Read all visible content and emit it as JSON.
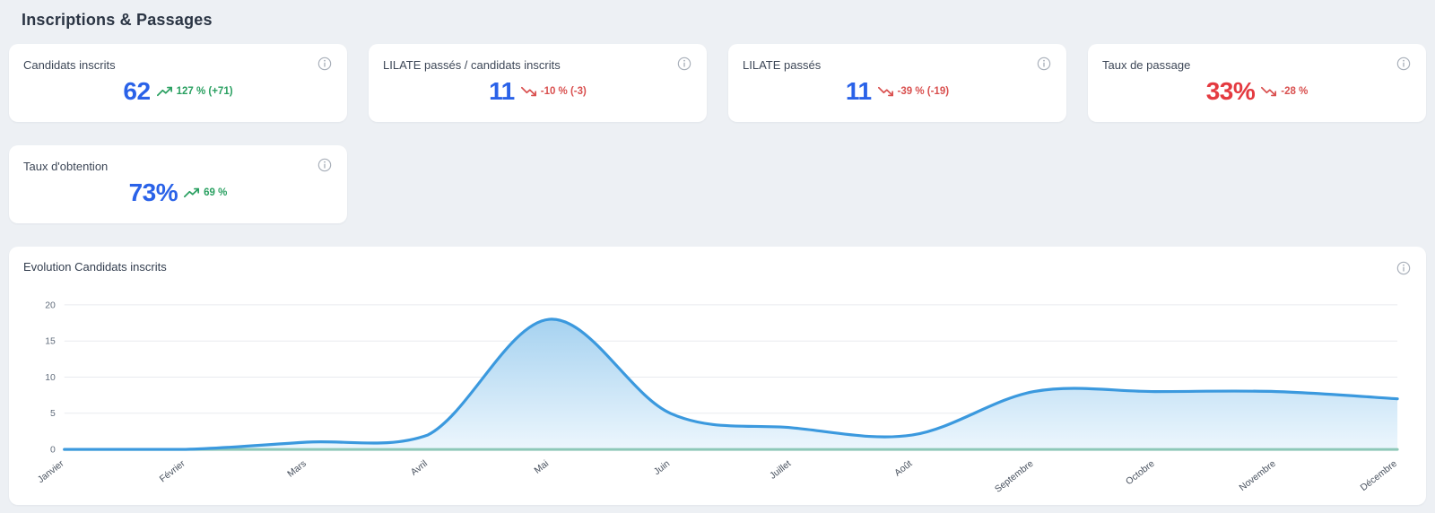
{
  "page": {
    "title": "Inscriptions & Passages"
  },
  "colors": {
    "accent_blue": "#2a62e8",
    "negative_red": "#e43a40",
    "positive_green": "#2aa061",
    "trend_red": "#d9504f",
    "line_blue": "#3b99de",
    "baseline_teal": "#8dc8b8",
    "area_top": "#a6d2f0",
    "area_bottom": "#ecf6fd"
  },
  "cards": [
    {
      "title": "Candidats inscrits",
      "value": "62",
      "value_color": "#2a62e8",
      "trend": "up",
      "trend_text": "127 % (+71)"
    },
    {
      "title": "LILATE passés / candidats inscrits",
      "value": "11",
      "value_color": "#2a62e8",
      "trend": "down",
      "trend_text": "-10 % (-3)"
    },
    {
      "title": "LILATE passés",
      "value": "11",
      "value_color": "#2a62e8",
      "trend": "down",
      "trend_text": "-39 % (-19)"
    },
    {
      "title": "Taux de passage",
      "value": "33%",
      "value_color": "#e43a40",
      "trend": "down",
      "trend_text": "-28 %"
    },
    {
      "title": "Taux d'obtention",
      "value": "73%",
      "value_color": "#2a62e8",
      "trend": "up",
      "trend_text": "69 %"
    }
  ],
  "chart_card": {
    "title": "Evolution Candidats inscrits"
  },
  "chart_data": {
    "type": "area",
    "title": "Evolution Candidats inscrits",
    "categories": [
      "Janvier",
      "Février",
      "Mars",
      "Avril",
      "Mai",
      "Juin",
      "Juillet",
      "Août",
      "Septembre",
      "Octobre",
      "Novembre",
      "Décembre"
    ],
    "series": [
      {
        "name": "Candidats inscrits",
        "values": [
          0,
          0,
          1,
          2,
          18,
          5,
          3,
          2,
          8,
          8,
          8,
          7
        ]
      },
      {
        "name": "baseline",
        "values": [
          0,
          0,
          0,
          0,
          0,
          0,
          0,
          0,
          0,
          0,
          0,
          0
        ]
      }
    ],
    "xlabel": "",
    "ylabel": "",
    "ylim": [
      0,
      20
    ],
    "yticks": [
      0,
      5,
      10,
      15,
      20
    ],
    "grid": true,
    "legend": "none",
    "x_label_rotation": -38
  }
}
